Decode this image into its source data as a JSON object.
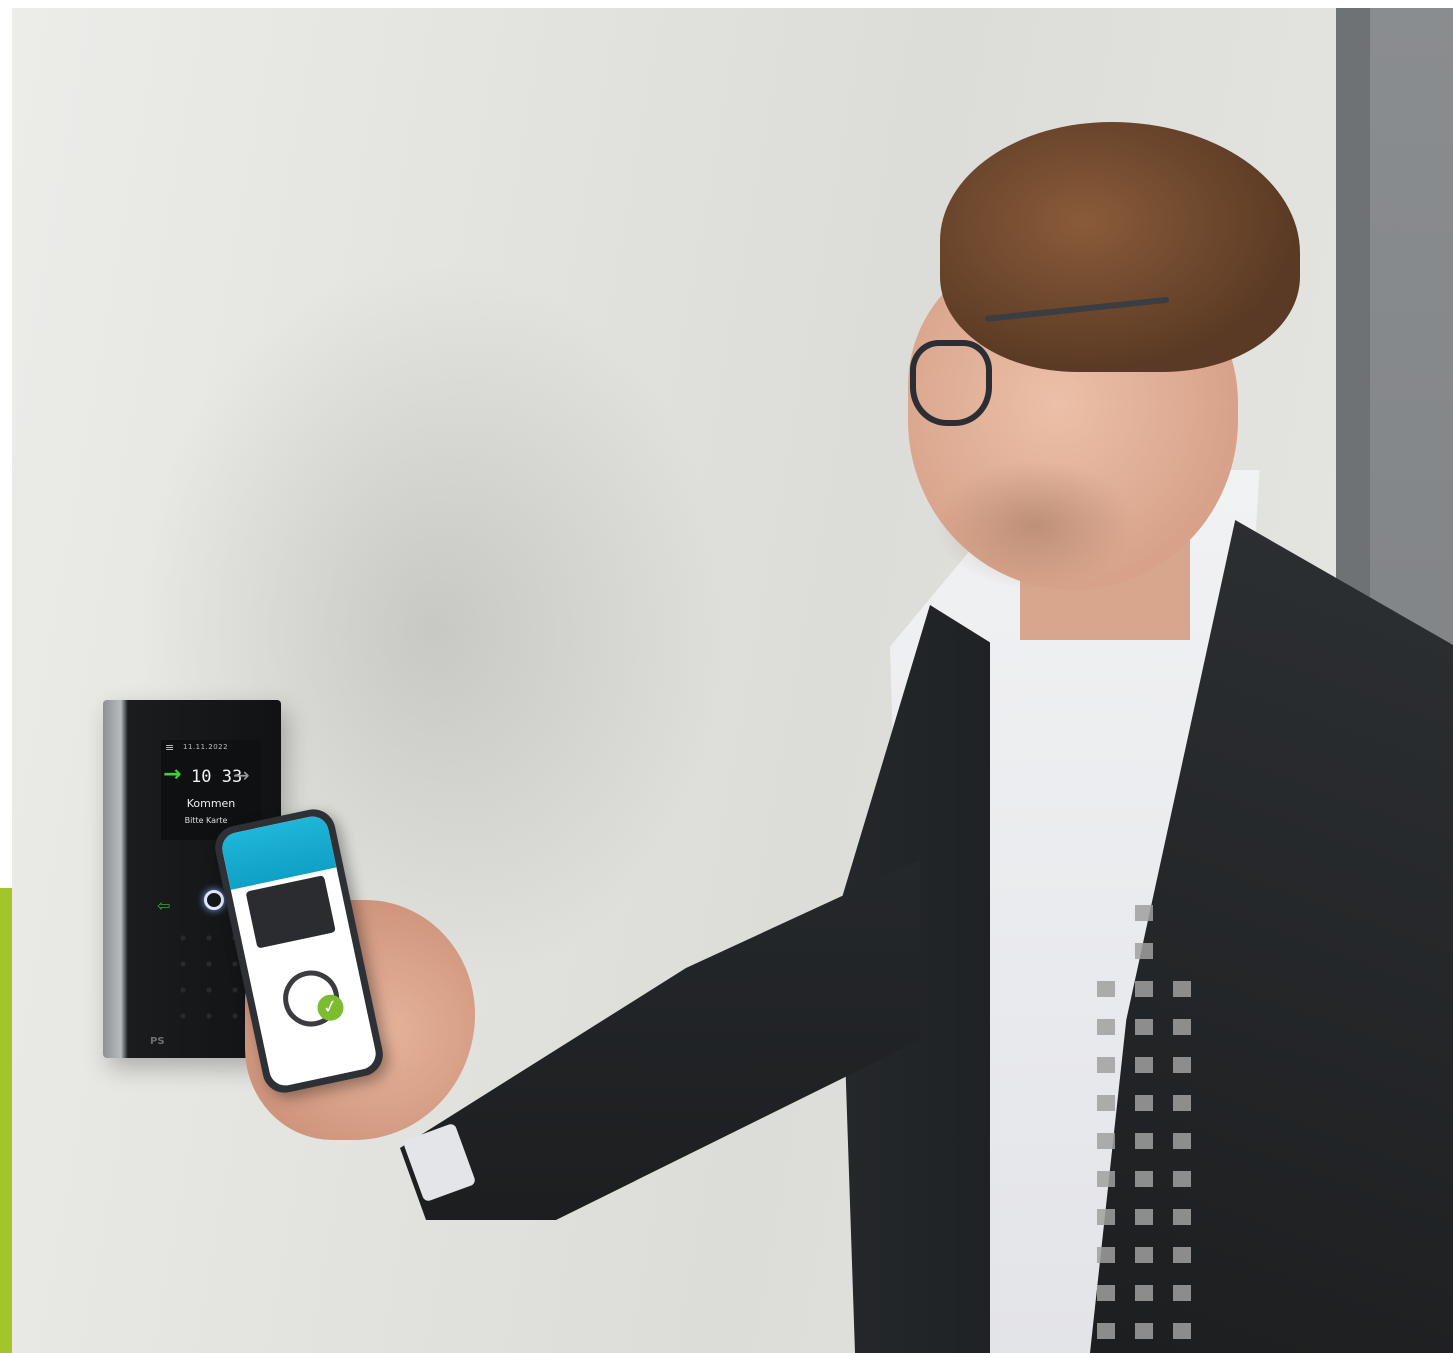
{
  "terminal": {
    "date": "11.11.2022",
    "time": "10 33",
    "status": "Kommen",
    "prompt": "Bitte Karte",
    "brand": "PS"
  },
  "colors": {
    "accent": "#a3c52a",
    "arrow_in": "#3fcf3a",
    "phone_header": "#1fb6d8",
    "check": "#7bbd2e"
  },
  "icons": [
    "menu-icon",
    "arrow-in-icon",
    "arrow-out-icon",
    "door-icon",
    "clock-icon",
    "check-icon"
  ]
}
